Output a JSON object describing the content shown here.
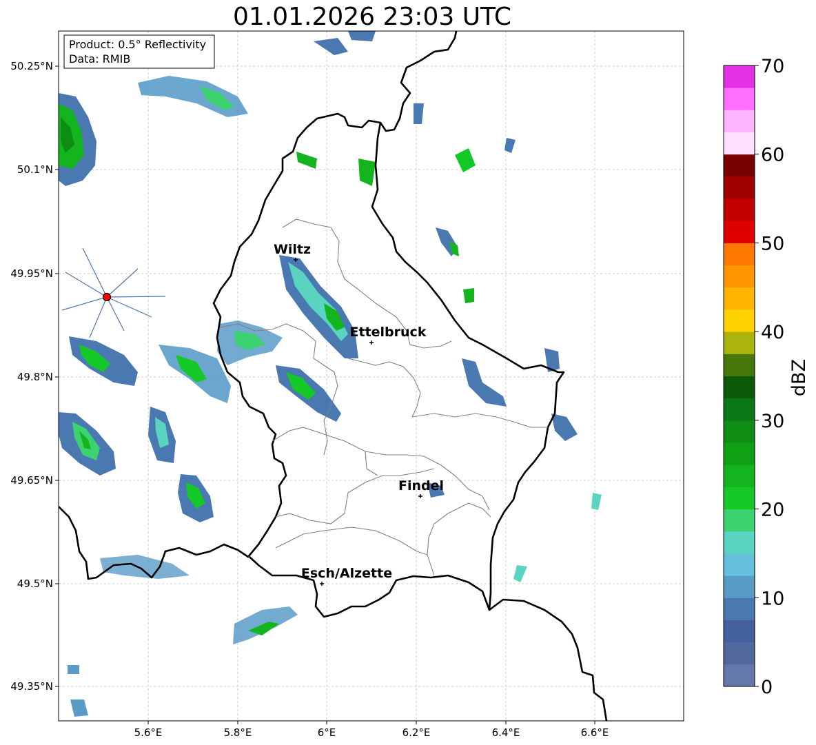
{
  "title": "01.01.2026 23:03 UTC",
  "info_box": {
    "product": "Product: 0.5° Reflectivity",
    "data": "Data: RMIB"
  },
  "axes": {
    "lon_ticks": [
      "5.6°E",
      "5.8°E",
      "6°E",
      "6.2°E",
      "6.4°E",
      "6.6°E"
    ],
    "lat_ticks": [
      "50.25°N",
      "50.1°N",
      "49.95°N",
      "49.8°N",
      "49.65°N",
      "49.5°N",
      "49.35°N"
    ],
    "lon_range": [
      5.4,
      6.8
    ],
    "lat_range": [
      49.3,
      50.3
    ]
  },
  "cities": [
    {
      "name": "Wiltz",
      "lon": 5.93,
      "lat": 49.97
    },
    {
      "name": "Ettelbruck",
      "lon": 6.1,
      "lat": 49.85
    },
    {
      "name": "Findel",
      "lon": 6.21,
      "lat": 49.63
    },
    {
      "name": "Esch/Alzette",
      "lon": 5.99,
      "lat": 49.5
    }
  ],
  "radar_site": {
    "lon": 5.505,
    "lat": 49.915
  },
  "colorbar": {
    "label": "dBZ",
    "ticks": [
      "0",
      "10",
      "20",
      "30",
      "40",
      "50",
      "60",
      "70"
    ],
    "colors": [
      "#6478aa",
      "#52699f",
      "#44609f",
      "#4a78b0",
      "#5a9cc8",
      "#64c0dc",
      "#5ad4c0",
      "#3cd270",
      "#14c828",
      "#14b41e",
      "#0fa014",
      "#0f8c14",
      "#0a7814",
      "#0a5a0a",
      "#46780a",
      "#aab40a",
      "#ffd200",
      "#ffb400",
      "#ff9600",
      "#ff7800",
      "#e10000",
      "#c30000",
      "#a00000",
      "#780000",
      "#ffe1ff",
      "#ffb4ff",
      "#ff6eff",
      "#e632e6"
    ]
  }
}
